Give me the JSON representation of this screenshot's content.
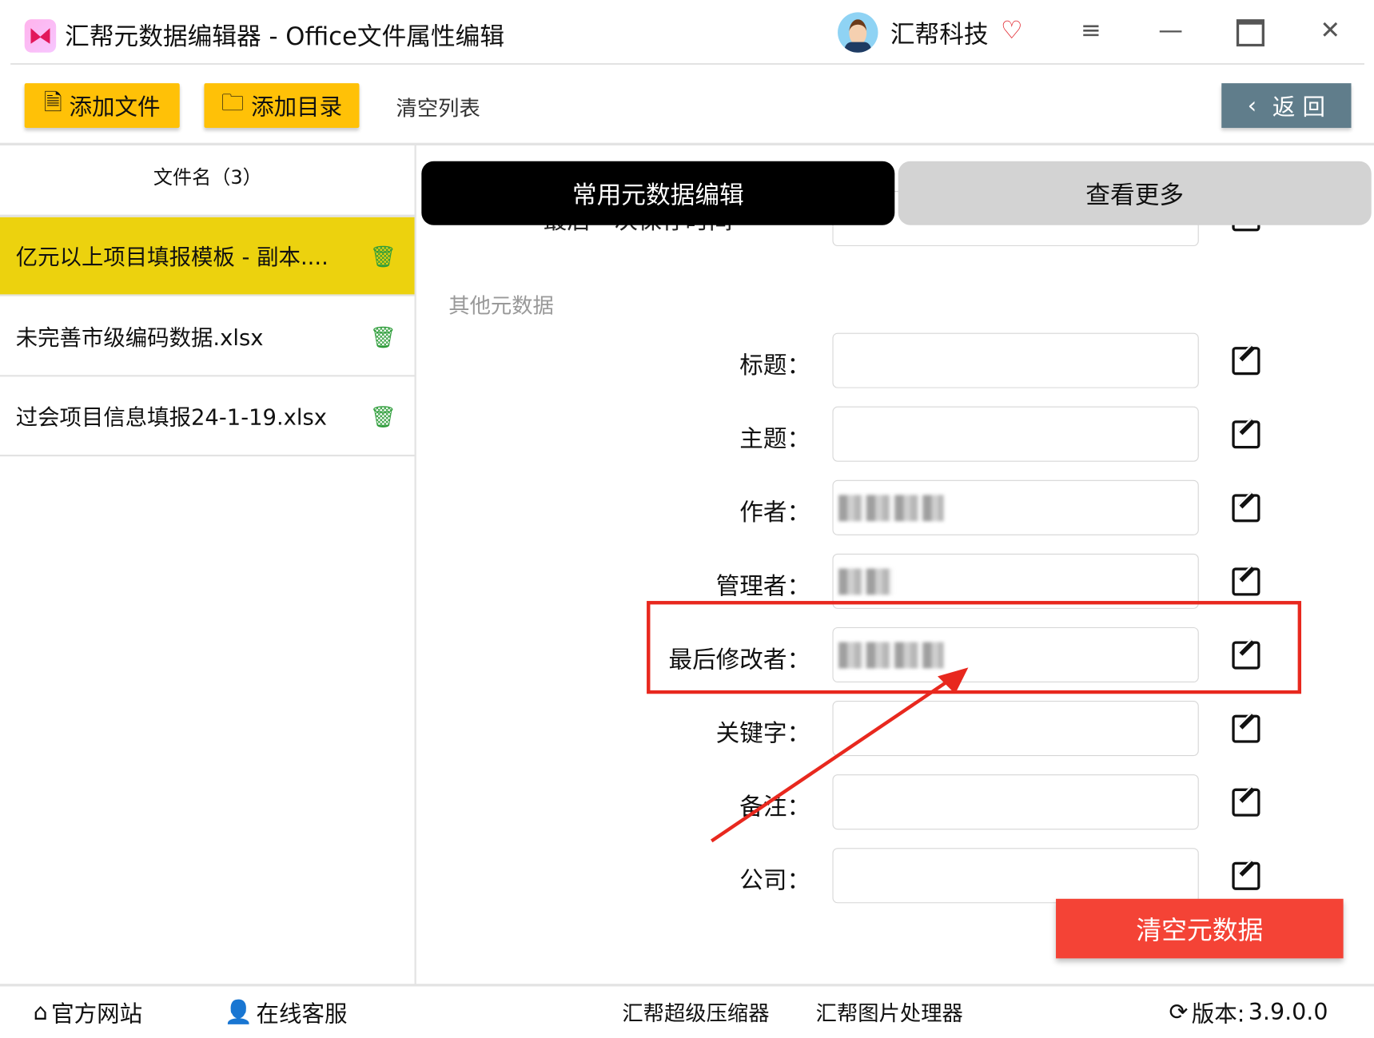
{
  "window": {
    "title": "汇帮元数据编辑器 - Office文件属性编辑",
    "company": "汇帮科技"
  },
  "toolbar": {
    "add_file": "添加文件",
    "add_folder": "添加目录",
    "clear_list": "清空列表",
    "back": "返 回"
  },
  "file_list": {
    "header": "文件名（3）",
    "items": [
      {
        "name": "亿元以上项目填报模板 - 副本....",
        "selected": true
      },
      {
        "name": "未完善市级编码数据.xlsx",
        "selected": false
      },
      {
        "name": "过会项目信息填报24-1-19.xlsx",
        "selected": false
      }
    ]
  },
  "tabs": [
    {
      "label": "常用元数据编辑",
      "active": true
    },
    {
      "label": "查看更多",
      "active": false
    }
  ],
  "partial_field": {
    "label": "最后一次保存时间"
  },
  "section": "其他元数据",
  "fields": [
    {
      "label": "标题：",
      "value": ""
    },
    {
      "label": "主题：",
      "value": ""
    },
    {
      "label": "作者：",
      "value": "",
      "redacted": true
    },
    {
      "label": "管理者：",
      "value": "",
      "redacted": true
    },
    {
      "label": "最后修改者：",
      "value": "",
      "redacted": true,
      "highlighted": true
    },
    {
      "label": "关键字：",
      "value": ""
    },
    {
      "label": "备注：",
      "value": ""
    },
    {
      "label": "公司：",
      "value": ""
    }
  ],
  "clear_metadata": "清空元数据",
  "footer": {
    "website": "官方网站",
    "support": "在线客服",
    "compressor": "汇帮超级压缩器",
    "image_tool": "汇帮图片处理器",
    "version_label": "版本:",
    "version": "3.9.0.0"
  },
  "colors": {
    "accent_yellow": "#ffc107",
    "selected_row": "#ecd20e",
    "danger": "#f44336",
    "back_button": "#607d8b",
    "highlight_box": "#e8281e"
  }
}
